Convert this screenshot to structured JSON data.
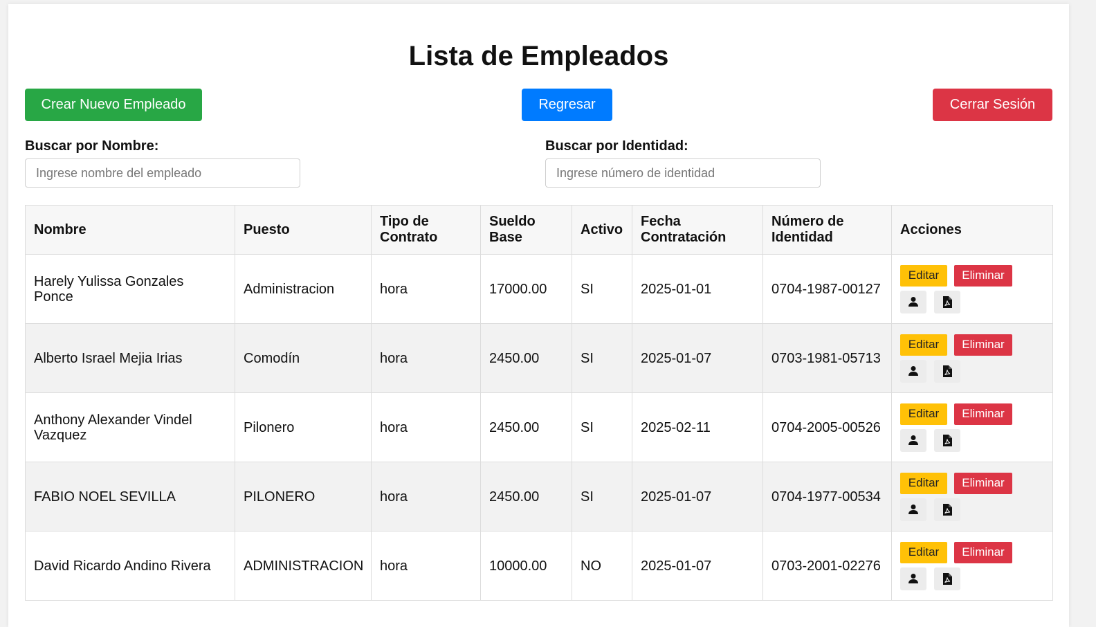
{
  "page": {
    "title": "Lista de Empleados"
  },
  "buttons": {
    "create": "Crear Nuevo Empleado",
    "back": "Regresar",
    "logout": "Cerrar Sesión"
  },
  "search": {
    "name_label": "Buscar por Nombre:",
    "name_placeholder": "Ingrese nombre del empleado",
    "id_label": "Buscar por Identidad:",
    "id_placeholder": "Ingrese número de identidad"
  },
  "table": {
    "headers": {
      "nombre": "Nombre",
      "puesto": "Puesto",
      "tipo": "Tipo de Contrato",
      "sueldo": "Sueldo Base",
      "activo": "Activo",
      "fecha": "Fecha Contratación",
      "identidad": "Número de Identidad",
      "acciones": "Acciones"
    },
    "rows": [
      {
        "nombre": "Harely Yulissa Gonzales Ponce",
        "puesto": "Administracion",
        "tipo": "hora",
        "sueldo": "17000.00",
        "activo": "SI",
        "fecha": "2025-01-01",
        "identidad": "0704-1987-00127"
      },
      {
        "nombre": "Alberto Israel Mejia Irias",
        "puesto": "Comodín",
        "tipo": "hora",
        "sueldo": "2450.00",
        "activo": "SI",
        "fecha": "2025-01-07",
        "identidad": "0703-1981-05713"
      },
      {
        "nombre": "Anthony Alexander Vindel Vazquez",
        "puesto": "Pilonero",
        "tipo": "hora",
        "sueldo": "2450.00",
        "activo": "SI",
        "fecha": "2025-02-11",
        "identidad": "0704-2005-00526"
      },
      {
        "nombre": "FABIO NOEL SEVILLA",
        "puesto": "PILONERO",
        "tipo": "hora",
        "sueldo": "2450.00",
        "activo": "SI",
        "fecha": "2025-01-07",
        "identidad": "0704-1977-00534"
      },
      {
        "nombre": "David Ricardo Andino Rivera",
        "puesto": "ADMINISTRACION",
        "tipo": "hora",
        "sueldo": "10000.00",
        "activo": "NO",
        "fecha": "2025-01-07",
        "identidad": "0703-2001-02276"
      }
    ],
    "row_actions": {
      "edit": "Editar",
      "delete": "Eliminar",
      "profile_icon": "user-icon",
      "pdf_icon": "pdf-file-icon"
    }
  },
  "colors": {
    "create": "#28a745",
    "back": "#007bff",
    "logout": "#dc3545",
    "edit": "#ffc107",
    "delete": "#dc3545"
  }
}
